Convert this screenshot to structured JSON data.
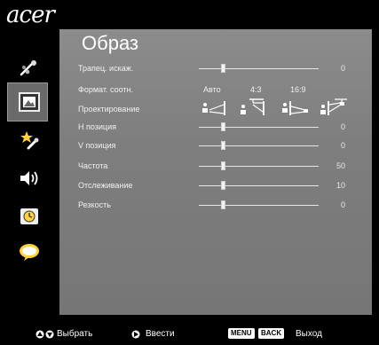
{
  "brand": "acer",
  "menu": {
    "title": "Образ",
    "items": [
      {
        "label": "Трапец. искаж.",
        "value": "0",
        "level": 0.2
      },
      {
        "label": "Формат. соотн.",
        "options": [
          "Авто",
          "4:3",
          "16:9"
        ]
      },
      {
        "label": "Проектирование"
      },
      {
        "label": "H позиция",
        "value": "0",
        "level": 0.2
      },
      {
        "label": "V позиция",
        "value": "0",
        "level": 0.2
      },
      {
        "label": "Частота",
        "value": "50",
        "level": 0.2
      },
      {
        "label": "Отслеживание",
        "value": "10",
        "level": 0.2
      },
      {
        "label": "Резкость",
        "value": "0",
        "level": 0.2
      }
    ]
  },
  "sidebar": {
    "icons": [
      "color-wand-icon",
      "image-settings-icon",
      "management-star-icon",
      "speaker-icon",
      "timer-icon",
      "language-icon"
    ],
    "selected_index": 1
  },
  "footer": {
    "select_label": "Выбрать",
    "enter_label": "Ввести",
    "menu_key": "MENU",
    "back_key": "BACK",
    "exit_label": "Выход"
  }
}
